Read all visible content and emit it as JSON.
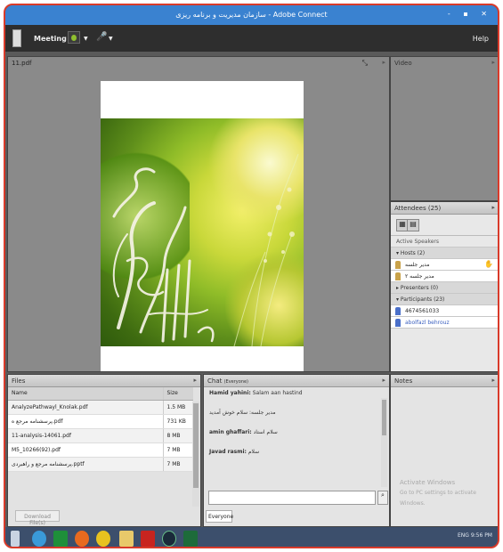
{
  "window": {
    "title": "سازمان مدیریت و برنامه ریزی - Adobe Connect",
    "controls": "- ▪ ✕"
  },
  "menubar": {
    "meeting": "Meeting",
    "help": "Help"
  },
  "share_pod": {
    "title": "11.pdf"
  },
  "video_pod": {
    "title": "Video"
  },
  "attendees_pod": {
    "title": "Attendees",
    "count": "(25)",
    "active_speakers": "Active Speakers",
    "hosts_group": "Hosts (2)",
    "hosts": [
      "مدیر جلسه",
      "مدیر جلسه ۲"
    ],
    "presenters_group": "Presenters (0)",
    "participants_group": "Participants (23)",
    "participants": [
      "4674561033",
      "abolfazl behrouz"
    ]
  },
  "files_pod": {
    "title": "Files",
    "col_name": "Name",
    "col_size": "Size",
    "rows": [
      {
        "name": "AnalyzePathwayl_Knolak.pdf",
        "size": "1.5 MB"
      },
      {
        "name": "پرسشنامه مرجع ه.pdf",
        "size": "731 KB"
      },
      {
        "name": "11-analysis-14061.pdf",
        "size": "8 MB"
      },
      {
        "name": "M5_10266(92).pdf",
        "size": "7 MB"
      },
      {
        "name": "پرسشنامه مرجع و راهبردی.pptf",
        "size": "7 MB"
      }
    ],
    "download_btn": "Download File(s)"
  },
  "chat_pod": {
    "title": "Chat",
    "scope": "(Everyone)",
    "messages": [
      {
        "sender": "Hamid yahini:",
        "text": "Salam aan hastind"
      },
      {
        "sender": "",
        "text": "مدیر جلسه: سلام خوش آمدید"
      },
      {
        "sender": "amin ghaffari:",
        "text": "سلام استاد"
      },
      {
        "sender": "Javad rasmi:",
        "text": "سلام"
      }
    ],
    "tab": "Everyone"
  },
  "notes_pod": {
    "title": "Notes",
    "watermark_title": "Activate Windows",
    "watermark_sub": "Go to PC settings to activate Windows."
  },
  "taskbar": {
    "tray_lang": "ENG",
    "tray_time": "9:56 PM"
  }
}
